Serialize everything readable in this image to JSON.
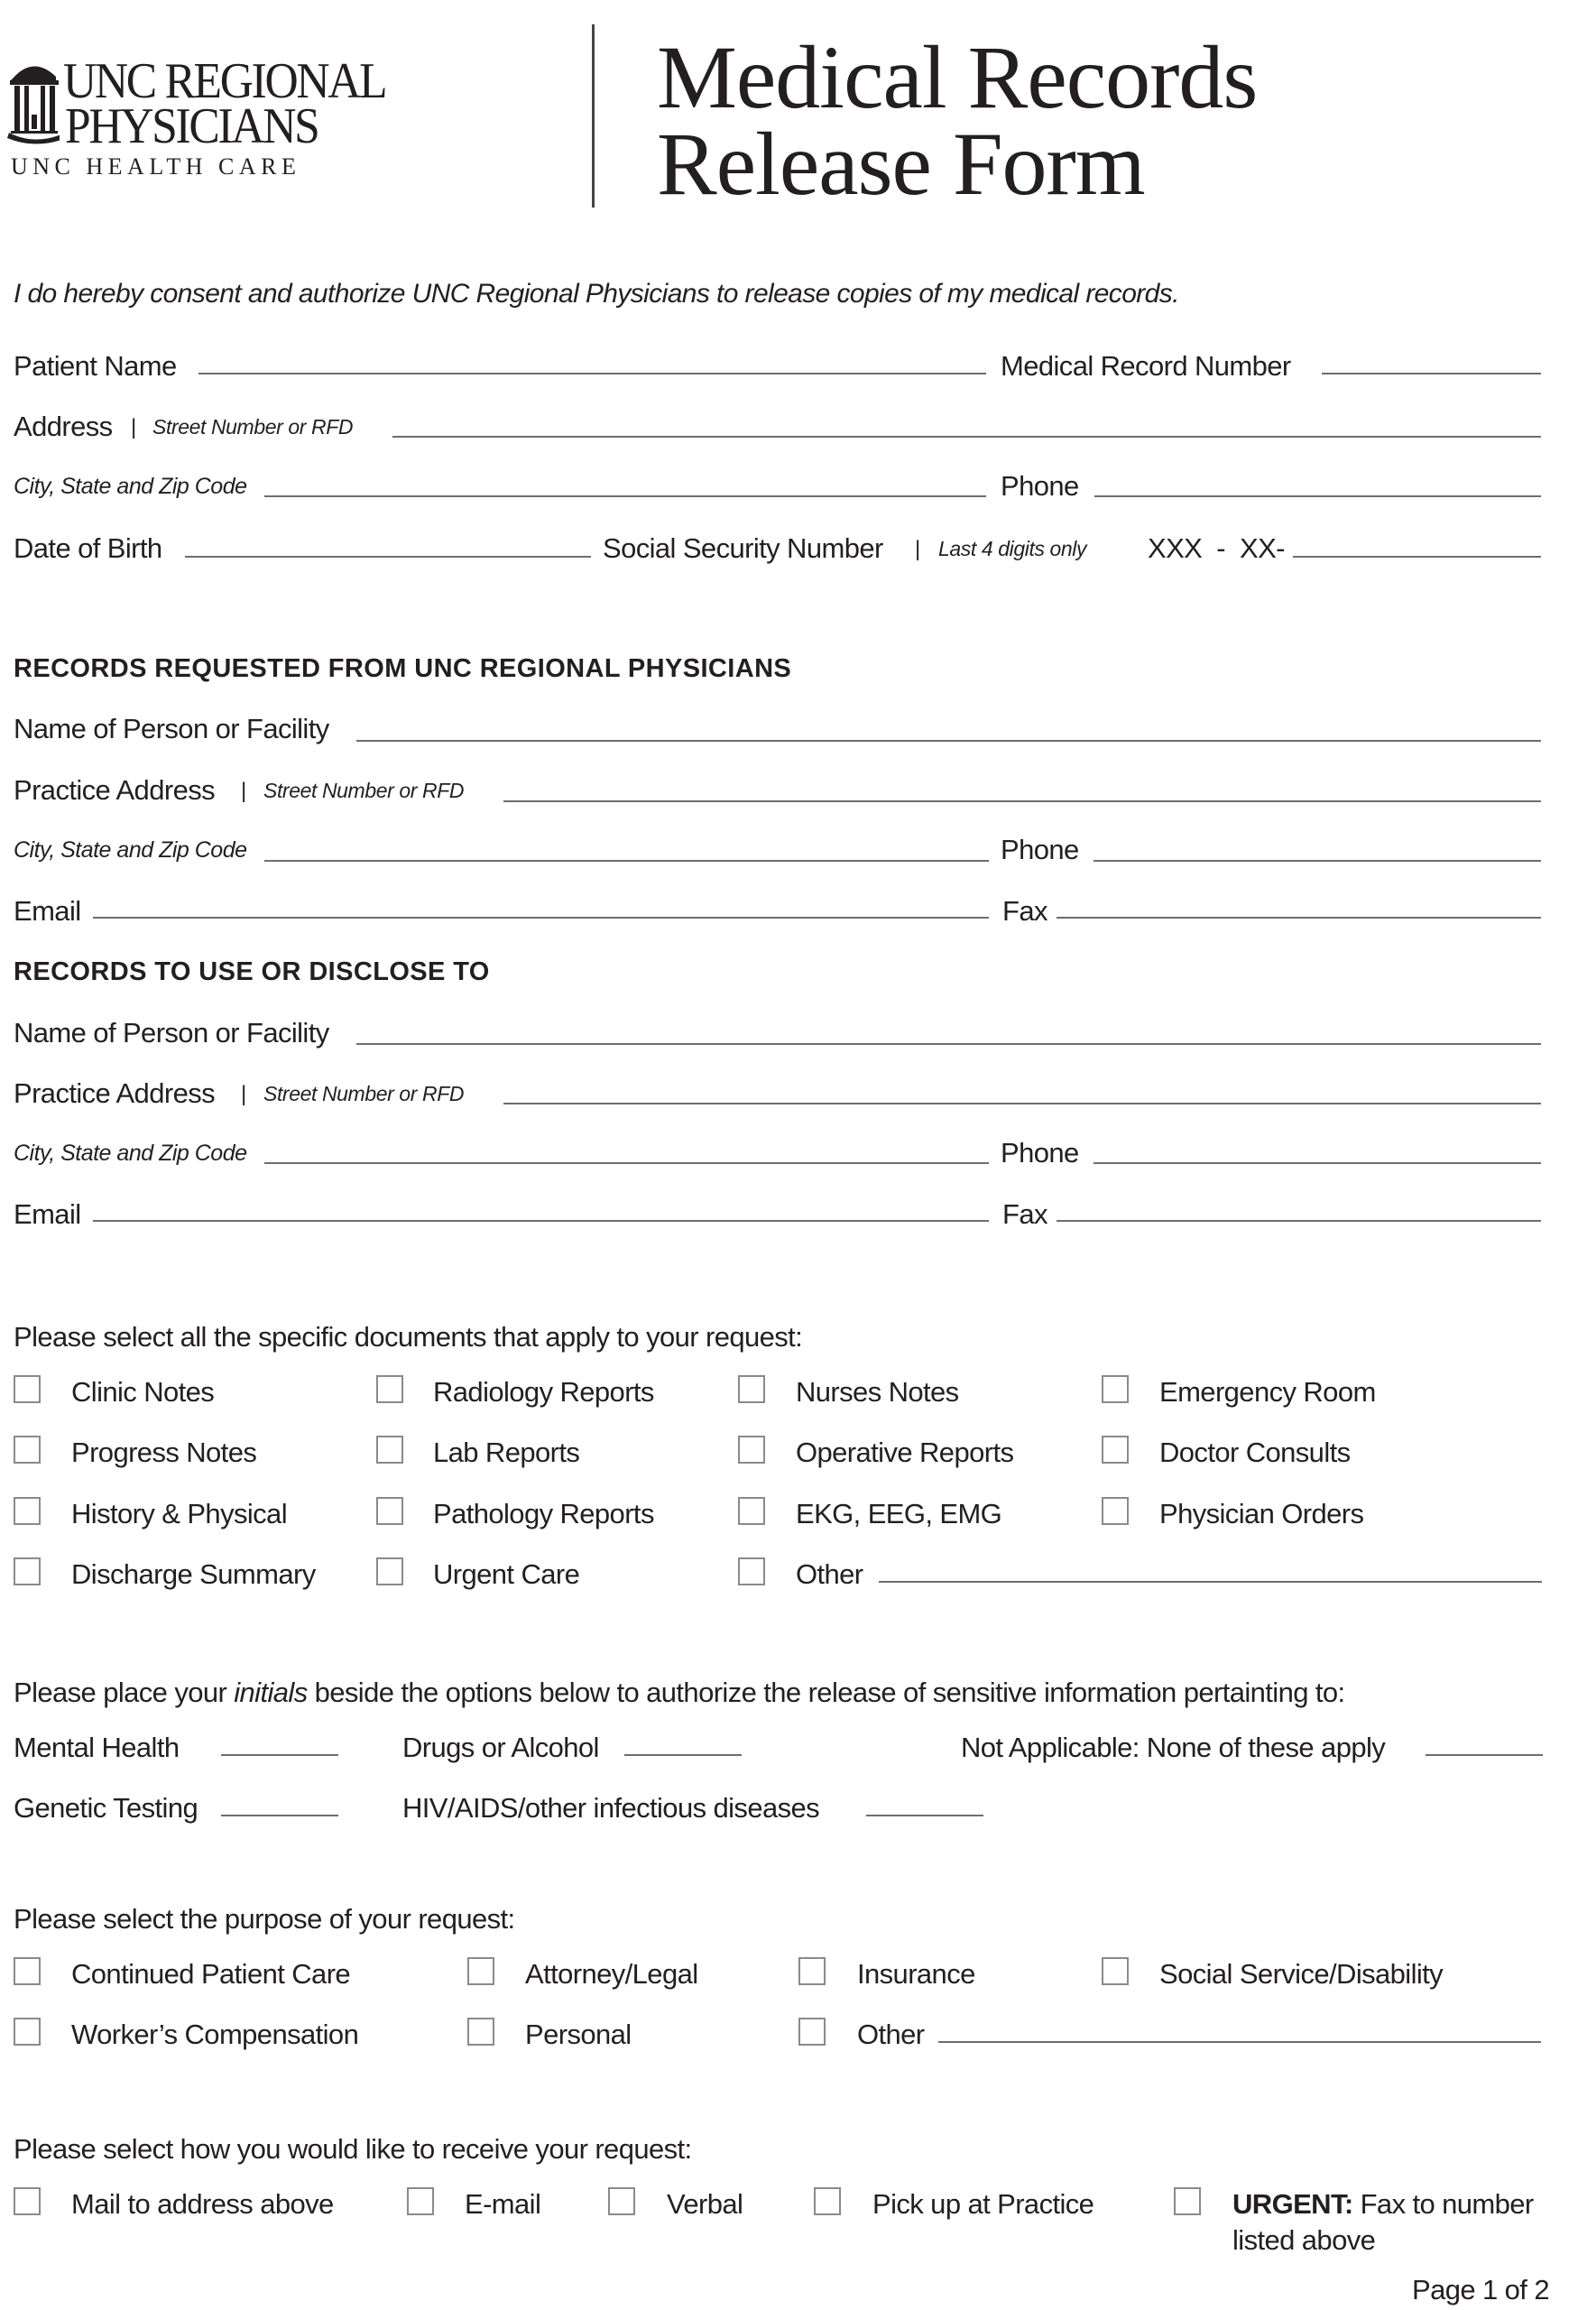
{
  "header": {
    "logo": {
      "line1": "UNC REGIONAL",
      "line2": "PHYSICIANS",
      "line3": "UNC HEALTH CARE",
      "icon": "old-well-icon"
    },
    "title_line1": "Medical Records",
    "title_line2": "Release Form"
  },
  "consent_text": "I do hereby consent and authorize UNC Regional Physicians to release copies of my medical records.",
  "patient": {
    "name_label": "Patient Name",
    "name_value": "",
    "mrn_label": "Medical Record Number",
    "mrn_value": "",
    "address_label": "Address",
    "address_sep": "|",
    "address_hint": "Street Number or RFD",
    "address_value": "",
    "city_label": "City, State and Zip Code",
    "city_value": "",
    "phone_label": "Phone",
    "phone_value": "",
    "dob_label": "Date of Birth",
    "dob_value": "",
    "ssn_label": "Social Security Number",
    "ssn_sep": "|",
    "ssn_hint": "Last 4 digits only",
    "ssn_prefix": "XXX  -  XX-",
    "ssn_value": ""
  },
  "requested_from": {
    "heading": "RECORDS REQUESTED FROM UNC REGIONAL PHYSICIANS",
    "name_label": "Name of Person or Facility",
    "address_label": "Practice Address",
    "address_sep": "|",
    "address_hint": "Street Number or RFD",
    "city_label": "City, State and Zip Code",
    "phone_label": "Phone",
    "email_label": "Email",
    "fax_label": "Fax"
  },
  "disclose_to": {
    "heading": "RECORDS TO USE OR DISCLOSE TO",
    "name_label": "Name of Person or Facility",
    "address_label": "Practice Address",
    "address_sep": "|",
    "address_hint": "Street Number or RFD",
    "city_label": "City, State and Zip Code",
    "phone_label": "Phone",
    "email_label": "Email",
    "fax_label": "Fax"
  },
  "documents": {
    "prompt": "Please select all the specific documents that apply to your request:",
    "items": [
      {
        "label": "Clinic Notes",
        "checked": false
      },
      {
        "label": "Radiology Reports",
        "checked": false
      },
      {
        "label": "Nurses Notes",
        "checked": false
      },
      {
        "label": "Emergency Room",
        "checked": false
      },
      {
        "label": "Progress Notes",
        "checked": false
      },
      {
        "label": "Lab Reports",
        "checked": false
      },
      {
        "label": "Operative Reports",
        "checked": false
      },
      {
        "label": "Doctor Consults",
        "checked": false
      },
      {
        "label": "History & Physical",
        "checked": false
      },
      {
        "label": "Pathology Reports",
        "checked": false
      },
      {
        "label": "EKG, EEG, EMG",
        "checked": false
      },
      {
        "label": "Physician Orders",
        "checked": false
      },
      {
        "label": "Discharge Summary",
        "checked": false
      },
      {
        "label": "Urgent Care",
        "checked": false
      },
      {
        "label": "Other",
        "checked": false
      }
    ]
  },
  "sensitive": {
    "prompt_before": "Please place your ",
    "prompt_em": "initials",
    "prompt_after": " beside the options below to authorize the release of sensitive information pertainting to:",
    "mental_health": "Mental Health",
    "drugs_alcohol": "Drugs or Alcohol",
    "not_applicable": "Not Applicable: None of these apply",
    "genetic_testing": "Genetic Testing",
    "hiv_aids": "HIV/AIDS/other infectious diseases"
  },
  "purpose": {
    "prompt": "Please select the purpose of your request:",
    "items": [
      {
        "label": "Continued Patient Care",
        "checked": false
      },
      {
        "label": "Attorney/Legal",
        "checked": false
      },
      {
        "label": "Insurance",
        "checked": false
      },
      {
        "label": "Social Service/Disability",
        "checked": false
      },
      {
        "label": "Worker’s Compensation",
        "checked": false
      },
      {
        "label": "Personal",
        "checked": false
      },
      {
        "label": "Other",
        "checked": false
      }
    ]
  },
  "delivery": {
    "prompt": "Please select how you would like to receive your request:",
    "items": [
      {
        "label": "Mail to address above",
        "checked": false
      },
      {
        "label": "E-mail",
        "checked": false
      },
      {
        "label": "Verbal",
        "checked": false
      },
      {
        "label": "Pick up at Practice",
        "checked": false
      }
    ],
    "urgent_bold": "URGENT:",
    "urgent_rest": " Fax to number",
    "urgent_line2": "listed above"
  },
  "footer": {
    "page": "Page 1 of 2"
  }
}
